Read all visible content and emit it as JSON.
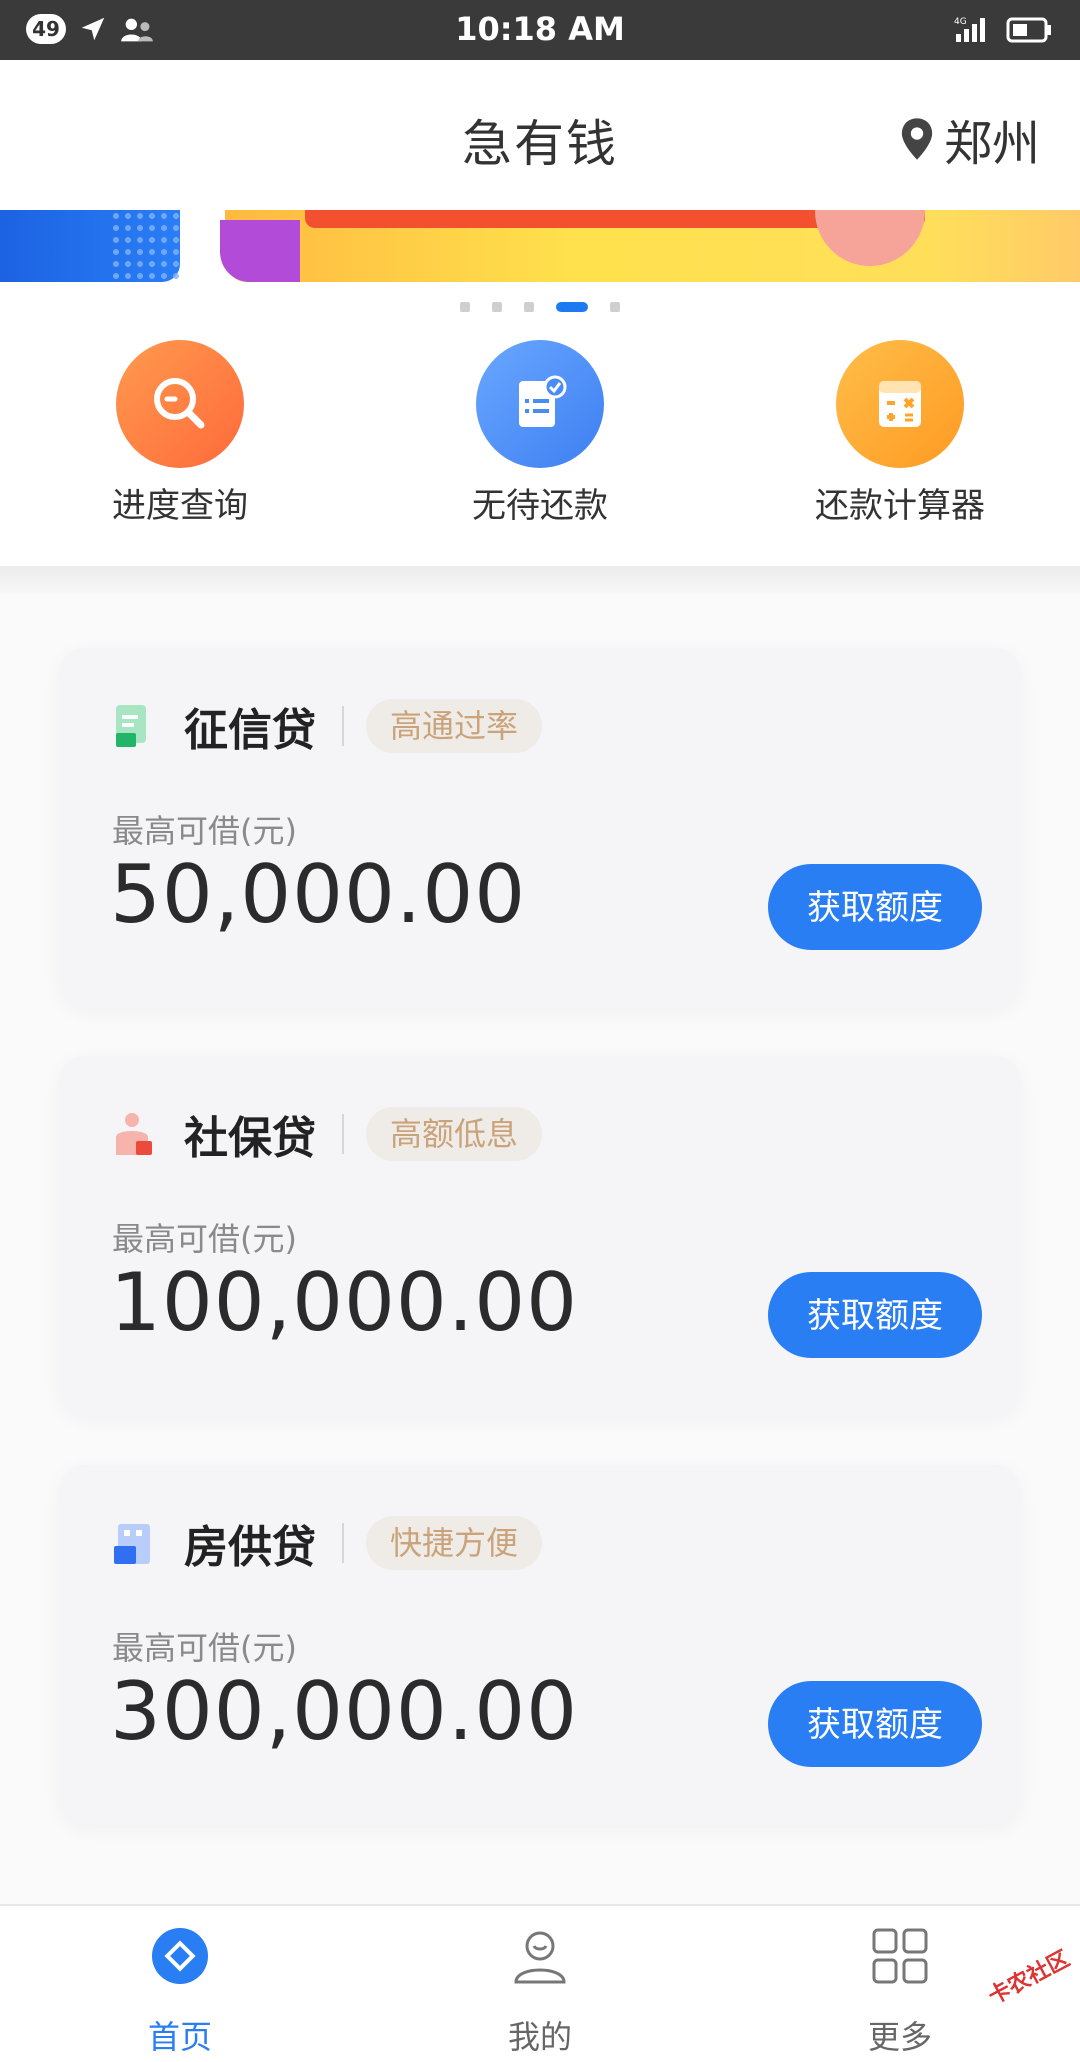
{
  "status_bar": {
    "notification_count": "49",
    "time": "10:18 AM",
    "network": "4G",
    "icons": [
      "location-arrow-icon",
      "person-icon",
      "signal-icon",
      "battery-icon"
    ]
  },
  "header": {
    "title": "急有钱",
    "city": "郑州",
    "city_icon": "map-pin-icon"
  },
  "banner": {
    "page_count": 5,
    "active_index": 3
  },
  "quick_menu": [
    {
      "label": "进度查询",
      "icon": "magnifier-icon",
      "color": "#ff7a3d"
    },
    {
      "label": "无待还款",
      "icon": "checklist-icon",
      "color": "#4a8cf6"
    },
    {
      "label": "还款计算器",
      "icon": "calculator-icon",
      "color": "#ffa42a"
    }
  ],
  "loans": [
    {
      "title": "征信贷",
      "tag": "高通过率",
      "sub": "最高可借(元)",
      "amount": "50,000.00",
      "button": "获取额度",
      "icon": "credit-doc-icon"
    },
    {
      "title": "社保贷",
      "tag": "高额低息",
      "sub": "最高可借(元)",
      "amount": "100,000.00",
      "button": "获取额度",
      "icon": "social-security-icon"
    },
    {
      "title": "房供贷",
      "tag": "快捷方便",
      "sub": "最高可借(元)",
      "amount": "300,000.00",
      "button": "获取额度",
      "icon": "building-icon"
    }
  ],
  "tabs": [
    {
      "label": "首页",
      "icon": "home-diamond-icon",
      "active": true
    },
    {
      "label": "我的",
      "icon": "user-icon",
      "active": false
    },
    {
      "label": "更多",
      "icon": "grid-icon",
      "active": false
    }
  ],
  "watermark": "卡农社区",
  "colors": {
    "accent": "#2a7ef3",
    "tag_text": "#caa37a",
    "status_bar": "#3a3a3a"
  }
}
